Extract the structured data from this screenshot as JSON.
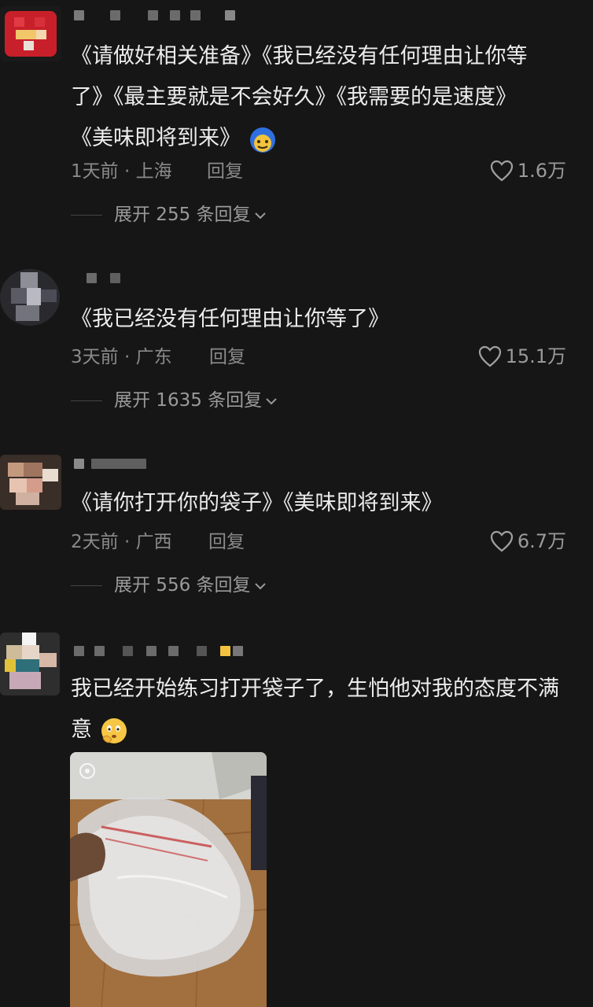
{
  "comments": [
    {
      "lines": [
        "《请做好相关准备》《我已经没有任何理由让你等",
        "了》《最主要就是不会好久》《我需要的是速度》",
        "《美味即将到来》"
      ],
      "emoji": "smiling-face-emoji",
      "time_location": "1天前 · 上海",
      "reply_label": "回复",
      "likes": "1.6万",
      "expand_label": "展开 255 条回复"
    },
    {
      "lines": [
        "《我已经没有任何理由让你等了》"
      ],
      "time_location": "3天前 · 广东",
      "reply_label": "回复",
      "likes": "15.1万",
      "expand_label": "展开 1635 条回复"
    },
    {
      "lines": [
        "《请你打开你的袋子》《美味即将到来》"
      ],
      "time_location": "2天前 · 广西",
      "reply_label": "回复",
      "likes": "6.7万",
      "expand_label": "展开 556 条回复"
    },
    {
      "lines": [
        "我已经开始练习打开袋子了，生怕他对我的态度不满",
        "意"
      ],
      "emoji": "thinking-face-emoji",
      "has_photo": true
    }
  ],
  "colors": {
    "background": "#161616",
    "text": "#ececec",
    "meta": "#8a8a8a"
  }
}
